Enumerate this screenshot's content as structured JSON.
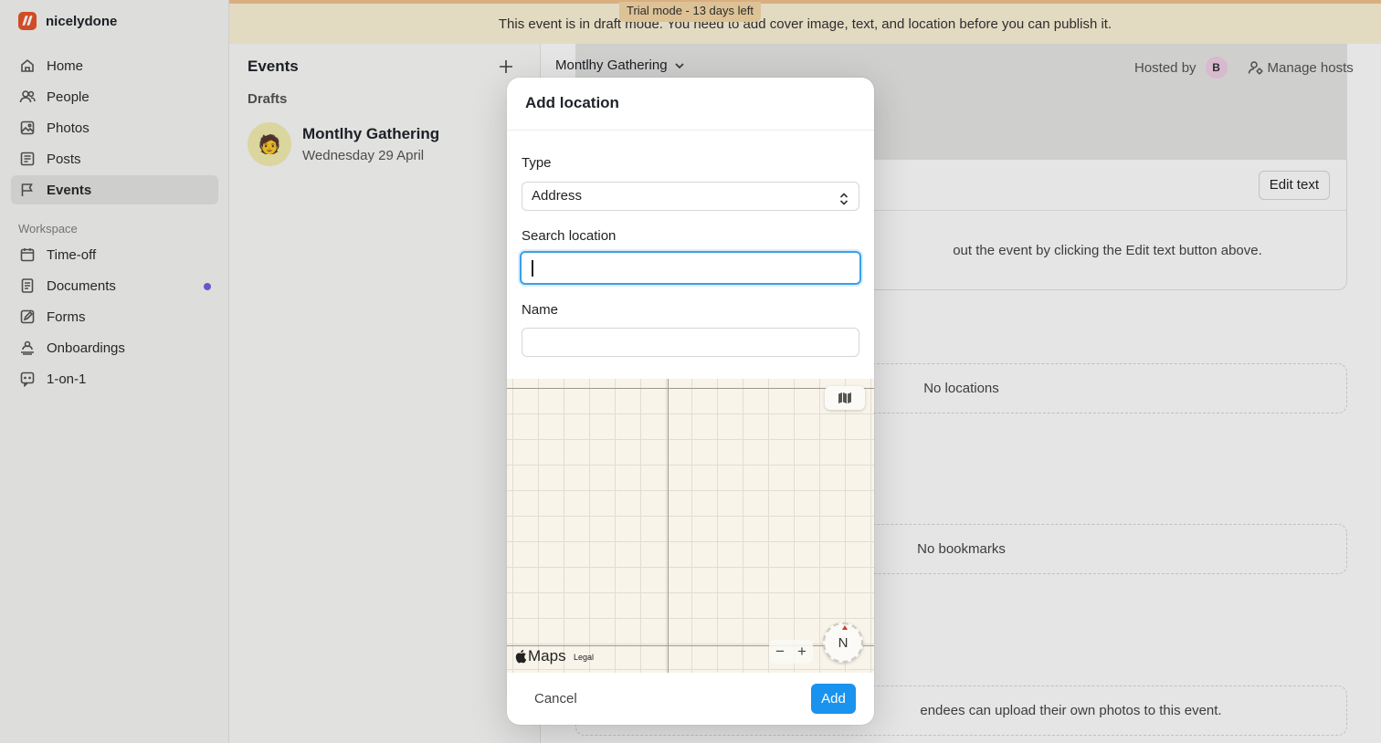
{
  "app": {
    "name": "nicelydone"
  },
  "sidebar": {
    "items": [
      {
        "label": "Home",
        "icon": "home-icon"
      },
      {
        "label": "People",
        "icon": "people-icon"
      },
      {
        "label": "Photos",
        "icon": "photo-icon"
      },
      {
        "label": "Posts",
        "icon": "posts-icon"
      },
      {
        "label": "Events",
        "icon": "flag-icon",
        "active": true
      }
    ],
    "workspace_label": "Workspace",
    "workspace_items": [
      {
        "label": "Time-off",
        "icon": "calendar-icon"
      },
      {
        "label": "Documents",
        "icon": "document-icon",
        "badge_color": "#7c5ce0"
      },
      {
        "label": "Forms",
        "icon": "form-icon"
      },
      {
        "label": "Onboardings",
        "icon": "onboarding-icon"
      },
      {
        "label": "1-on-1",
        "icon": "chat-icon"
      }
    ]
  },
  "banner": {
    "message": "This event is in draft mode. You need to add cover image, text, and location before you can publish it.",
    "trial": "Trial mode - 13 days left"
  },
  "events_panel": {
    "title": "Events",
    "drafts_label": "Drafts",
    "event": {
      "name": "Montlhy Gathering",
      "date": "Wednesday 29 April",
      "avatar": "🧑"
    }
  },
  "main": {
    "event_select": "Montlhy Gathering",
    "hosted_by": "Hosted by",
    "host_initial": "B",
    "manage_hosts": "Manage hosts",
    "edit_text": "Edit text",
    "text_hint": "out the event by clicking the Edit text button above.",
    "no_locations": "No locations",
    "no_bookmarks": "No bookmarks",
    "photos_hint": "endees can upload their own photos to this event."
  },
  "modal": {
    "title": "Add location",
    "type_label": "Type",
    "type_value": "Address",
    "search_label": "Search location",
    "search_value": "",
    "name_label": "Name",
    "name_value": "",
    "map": {
      "brand": "Maps",
      "legal": "Legal",
      "zoom_out": "−",
      "zoom_in": "+",
      "compass": "N"
    },
    "cancel": "Cancel",
    "add": "Add"
  },
  "colors": {
    "accent": "#1a93ee",
    "banner": "#fdf3d9",
    "focus": "#3aa0e8",
    "brand": "#e8552b"
  }
}
